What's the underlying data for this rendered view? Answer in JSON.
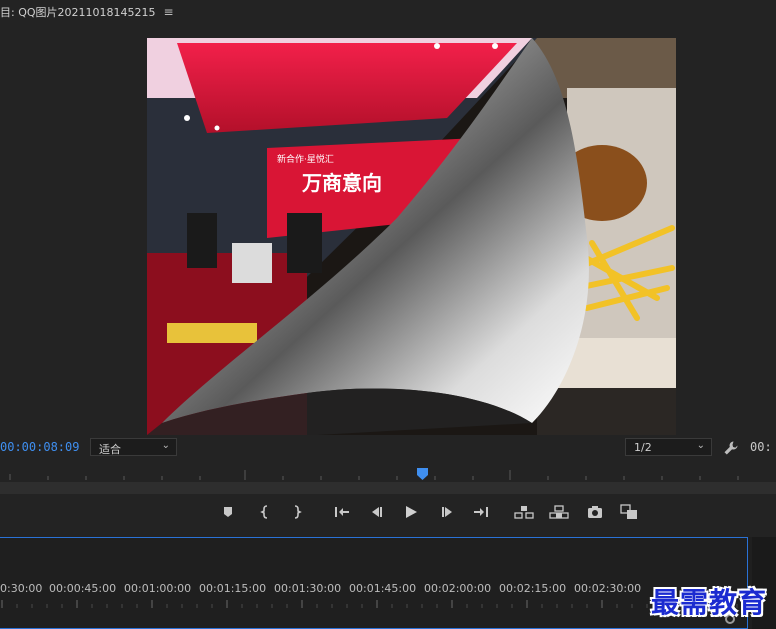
{
  "monitor": {
    "title": "目: QQ图片20211018145215",
    "menu_icon": "≡",
    "timecode_current": "00:00:08:09",
    "fit_select": {
      "selected": "适合"
    },
    "resolution_select": {
      "selected": "1/2"
    },
    "timecode_right": "00:",
    "preview": {
      "stage_text": "新合作·星悦汇",
      "banner_text": "万商意向"
    }
  },
  "transport": {
    "buttons": [
      "add-marker",
      "mark-in",
      "mark-out",
      "go-to-in",
      "step-back",
      "play",
      "step-forward",
      "go-to-out",
      "insert",
      "overwrite",
      "export-frame",
      "compare-view"
    ]
  },
  "timeline": {
    "ruler_labels": [
      "0:30:00",
      "00:00:45:00",
      "00:01:00:00",
      "00:01:15:00",
      "00:01:30:00",
      "00:01:45:00",
      "00:02:00:00",
      "00:02:15:00",
      "00:02:30:00"
    ],
    "watermark": "最需教育"
  },
  "colors": {
    "accent_blue": "#3f8ff0",
    "panel_bg": "#232323",
    "stage_red": "#e3183c",
    "watermark_blue": "#1b2bd0"
  }
}
